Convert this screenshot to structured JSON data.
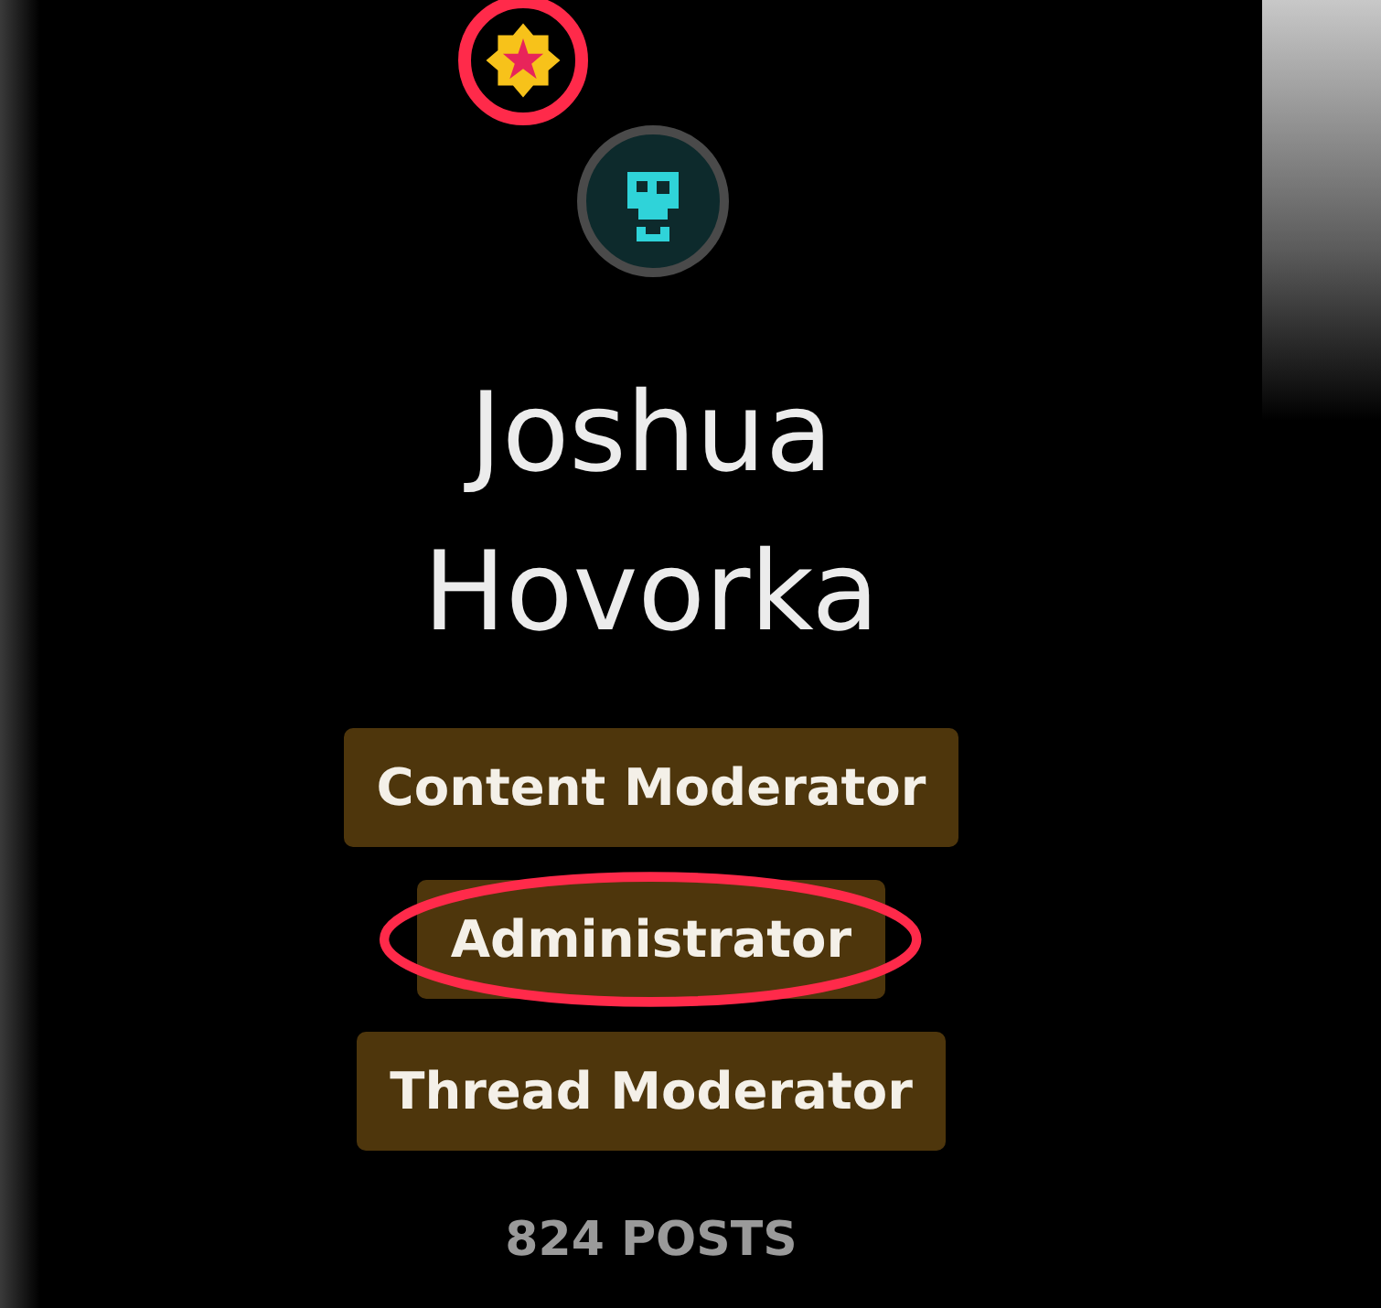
{
  "profile": {
    "badge_highlighted": true,
    "name": "Joshua Hovorka",
    "roles": [
      {
        "label": "Content Moderator",
        "highlighted": false
      },
      {
        "label": "Administrator",
        "highlighted": true
      },
      {
        "label": "Thread Moderator",
        "highlighted": false
      }
    ],
    "posts": "824 POSTS"
  }
}
